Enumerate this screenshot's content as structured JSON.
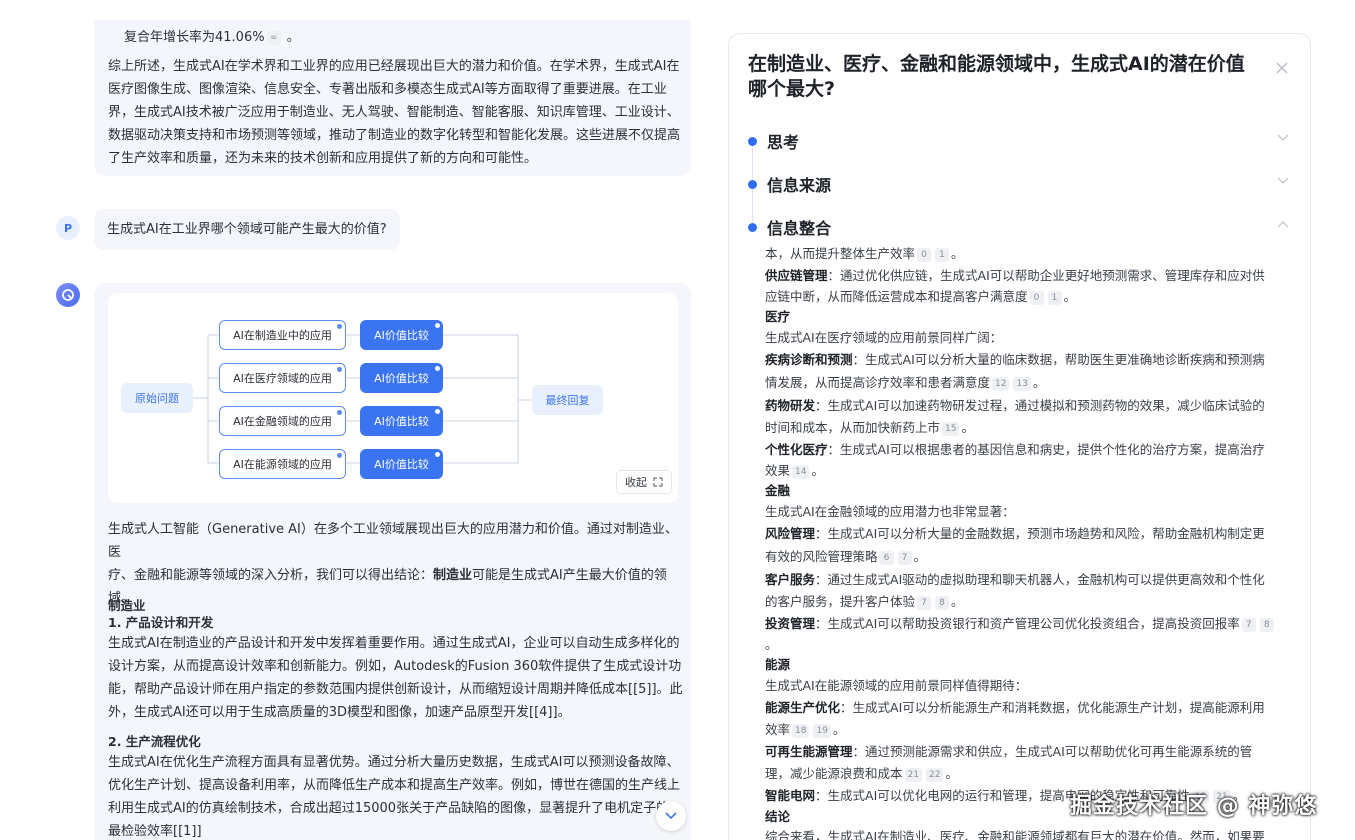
{
  "chat": {
    "top_bubble": {
      "line0": "复合年增长率为41.06%",
      "paragraph": [
        "综上所述，生成式AI在学术界和工业界的应用已经展现出巨大的潜力和价值。在学术界，生成式AI在",
        "医疗图像生成、图像渲染、信息安全、专著出版和多模态生成式AI等方面取得了重要进展。在工业",
        "界，生成式AI技术被广泛应用于制造业、无人驾驶、智能制造、智能客服、知识库管理、工业设计、",
        "数据驱动决策支持和市场预测等领域，推动了制造业的数字化转型和智能化发展。这些进展不仅提高",
        "了生产效率和质量，还为未来的技术创新和应用提供了新的方向和可能性。"
      ]
    },
    "user": {
      "avatar_letter": "P",
      "question": "生成式AI在工业界哪个领域可能产生最大的价值?"
    },
    "mindmap": {
      "root": "原始问题",
      "branches": [
        "AI在制造业中的应用",
        "AI在医疗领域的应用",
        "AI在金融领域的应用",
        "AI在能源领域的应用"
      ],
      "compare_label": "AI价值比较",
      "final": "最终回复",
      "collapse": "收起"
    },
    "answer": {
      "intro": [
        "生成式人工智能（Generative AI）在多个工业领域展现出巨大的应用潜力和价值。通过对制造业、医",
        "疗、金融和能源等领域的深入分析，我们可以得出结论：",
        "制造业",
        "可能是生成式AI产生最大价值的领",
        "域。"
      ],
      "h_manufacturing": "制造业",
      "h1": "1. 产品设计和开发",
      "p1": [
        "生成式AI在制造业的产品设计和开发中发挥着重要作用。通过生成式AI，企业可以自动生成多样化的",
        "设计方案，从而提高设计效率和创新能力。例如，Autodesk的Fusion 360软件提供了生成式设计功",
        "能，帮助产品设计师在用户指定的参数范围内提供创新设计，从而缩短设计周期并降低成本[[5]]。此",
        "外，生成式AI还可以用于生成高质量的3D模型和图像，加速产品原型开发[[4]]。"
      ],
      "h2": "2. 生产流程优化",
      "p2": [
        "生成式AI在优化生产流程方面具有显著优势。通过分析大量历史数据，生成式AI可以预测设备故障、",
        "优化生产计划、提高设备利用率，从而降低生产成本和提高生产效率。例如，博世在德国的生产线上",
        "利用生成式AI的仿真绘制技术，合成出超过15000张关于产品缺陷的图像，显著提升了电机定子的",
        "最检验效率[[1]]"
      ]
    }
  },
  "panel": {
    "title": [
      "在制造业、医疗、金融和能源领域中，生成式AI的潜在价值",
      "哪个最大?"
    ],
    "steps": [
      "思考",
      "信息来源",
      "信息整合"
    ],
    "lines": [
      {
        "b": "",
        "t": "本，从而提升整体生产效率",
        "refs": [
          "0",
          "1"
        ],
        "end": "。"
      },
      {
        "b": "供应链管理",
        "t": "：通过优化供应链，生成式AI可以帮助企业更好地预测需求、管理库存和应对供",
        "refs": [],
        "end": ""
      },
      {
        "b": "",
        "t": "应链中断，从而降低运营成本和提高客户满意度",
        "refs": [
          "0",
          "1"
        ],
        "end": "。"
      },
      {
        "b": "医疗",
        "t": "",
        "refs": [],
        "end": ""
      },
      {
        "b": "",
        "t": "生成式AI在医疗领域的应用前景同样广阔：",
        "refs": [],
        "end": ""
      },
      {
        "b": "疾病诊断和预测",
        "t": "：生成式AI可以分析大量的临床数据，帮助医生更准确地诊断疾病和预测病",
        "refs": [],
        "end": ""
      },
      {
        "b": "",
        "t": "情发展，从而提高诊疗效率和患者满意度",
        "refs": [
          "12",
          "13"
        ],
        "end": "。"
      },
      {
        "b": "药物研发",
        "t": "：生成式AI可以加速药物研发过程，通过模拟和预测药物的效果，减少临床试验的",
        "refs": [],
        "end": ""
      },
      {
        "b": "",
        "t": "时间和成本，从而加快新药上市",
        "refs": [
          "15"
        ],
        "end": "。"
      },
      {
        "b": "个性化医疗",
        "t": "：生成式AI可以根据患者的基因信息和病史，提供个性化的治疗方案，提高治疗",
        "refs": [],
        "end": ""
      },
      {
        "b": "",
        "t": "效果",
        "refs": [
          "14"
        ],
        "end": "。"
      },
      {
        "b": "金融",
        "t": "",
        "refs": [],
        "end": ""
      },
      {
        "b": "",
        "t": "生成式AI在金融领域的应用潜力也非常显著：",
        "refs": [],
        "end": ""
      },
      {
        "b": "风险管理",
        "t": "：生成式AI可以分析大量的金融数据，预测市场趋势和风险，帮助金融机构制定更",
        "refs": [],
        "end": ""
      },
      {
        "b": "",
        "t": "有效的风险管理策略",
        "refs": [
          "6",
          "7"
        ],
        "end": "。"
      },
      {
        "b": "客户服务",
        "t": "：通过生成式AI驱动的虚拟助理和聊天机器人，金融机构可以提供更高效和个性化",
        "refs": [],
        "end": ""
      },
      {
        "b": "",
        "t": "的客户服务，提升客户体验",
        "refs": [
          "7",
          "8"
        ],
        "end": "。"
      },
      {
        "b": "投资管理",
        "t": "：生成式AI可以帮助投资银行和资产管理公司优化投资组合，提高投资回报率",
        "refs": [
          "7",
          "8"
        ],
        "end": ""
      },
      {
        "b": "",
        "t": "。",
        "refs": [],
        "end": ""
      },
      {
        "b": "能源",
        "t": "",
        "refs": [],
        "end": ""
      },
      {
        "b": "",
        "t": "生成式AI在能源领域的应用前景同样值得期待：",
        "refs": [],
        "end": ""
      },
      {
        "b": "能源生产优化",
        "t": "：生成式AI可以分析能源生产和消耗数据，优化能源生产计划，提高能源利用",
        "refs": [],
        "end": ""
      },
      {
        "b": "",
        "t": "效率",
        "refs": [
          "18",
          "19"
        ],
        "end": "。"
      },
      {
        "b": "可再生能源管理",
        "t": "：通过预测能源需求和供应，生成式AI可以帮助优化可再生能源系统的管",
        "refs": [],
        "end": ""
      },
      {
        "b": "",
        "t": "理，减少能源浪费和成本",
        "refs": [
          "21",
          "22"
        ],
        "end": "。"
      },
      {
        "b": "智能电网",
        "t": "：生成式AI可以优化电网的运行和管理，提高电网的稳定性和可靠性",
        "refs": [
          "19",
          "21"
        ],
        "end": "。"
      },
      {
        "b": "结论",
        "t": "",
        "refs": [],
        "end": ""
      },
      {
        "b": "",
        "t": "综合来看，生成式AI在制造业、医疗、金融和能源领域都有巨大的潜在价值。然而，如果要",
        "refs": [],
        "end": ""
      }
    ]
  },
  "watermark": "掘金技术社区 @ 神弥悠",
  "colors": {
    "accent": "#3b74f0",
    "bubble": "#f4f6fb",
    "dot": "#2f6df2"
  }
}
